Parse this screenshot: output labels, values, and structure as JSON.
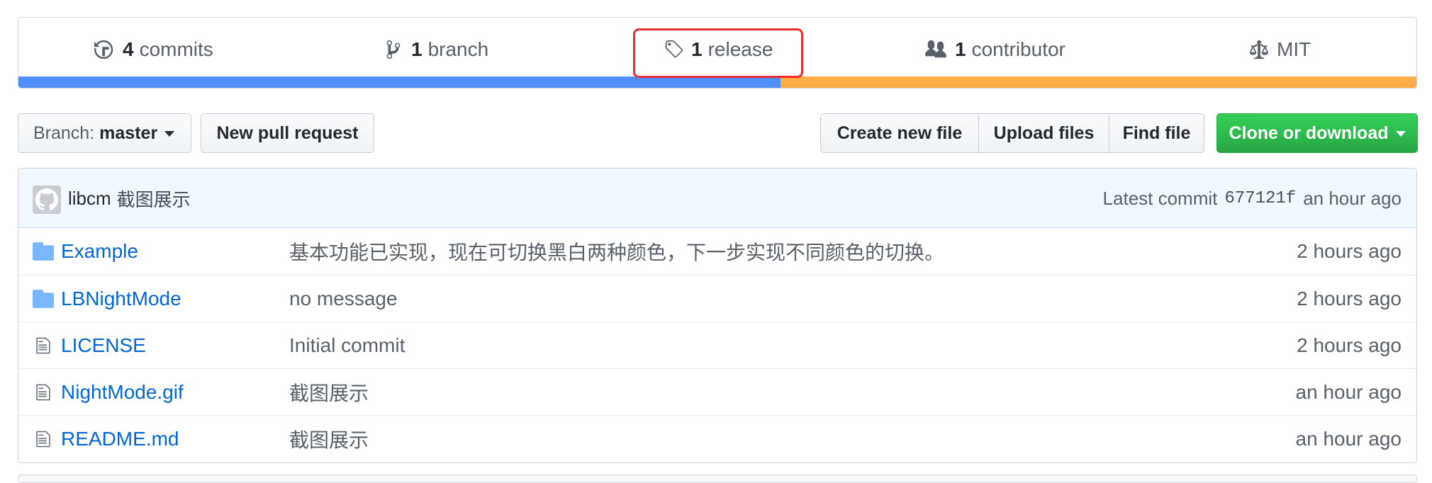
{
  "summary": {
    "commits": {
      "count": "4",
      "label": "commits",
      "icon": "history-icon"
    },
    "branches": {
      "count": "1",
      "label": "branch",
      "icon": "git-branch-icon"
    },
    "releases": {
      "count": "1",
      "label": "release",
      "icon": "tag-icon"
    },
    "contributors": {
      "count": "1",
      "label": "contributor",
      "icon": "people-icon"
    },
    "license": {
      "label": "MIT",
      "icon": "law-icon"
    },
    "languages": [
      {
        "color": "#4f8ff7",
        "fraction": 0.545
      },
      {
        "color": "#ffac45",
        "fraction": 0.455
      }
    ]
  },
  "toolbar": {
    "branch_prefix": "Branch:",
    "branch_name": "master",
    "new_pull_request": "New pull request",
    "create_new_file": "Create new file",
    "upload_files": "Upload files",
    "find_file": "Find file",
    "clone_or_download": "Clone or download"
  },
  "latest_commit": {
    "author": "libcm",
    "message": "截图展示",
    "prefix": "Latest commit",
    "sha": "677121f",
    "age": "an hour ago"
  },
  "files": [
    {
      "type": "folder",
      "name": "Example",
      "message": "基本功能已实现，现在可切换黑白两种颜色，下一步实现不同颜色的切换。",
      "age": "2 hours ago"
    },
    {
      "type": "folder",
      "name": "LBNightMode",
      "message": "no message",
      "age": "2 hours ago"
    },
    {
      "type": "file",
      "name": "LICENSE",
      "message": "Initial commit",
      "age": "2 hours ago"
    },
    {
      "type": "file",
      "name": "NightMode.gif",
      "message": "截图展示",
      "age": "an hour ago"
    },
    {
      "type": "file",
      "name": "README.md",
      "message": "截图展示",
      "age": "an hour ago"
    }
  ],
  "colors": {
    "link": "#0366d6",
    "highlight": "#ef2b2b",
    "clone_green": "#28a745"
  }
}
